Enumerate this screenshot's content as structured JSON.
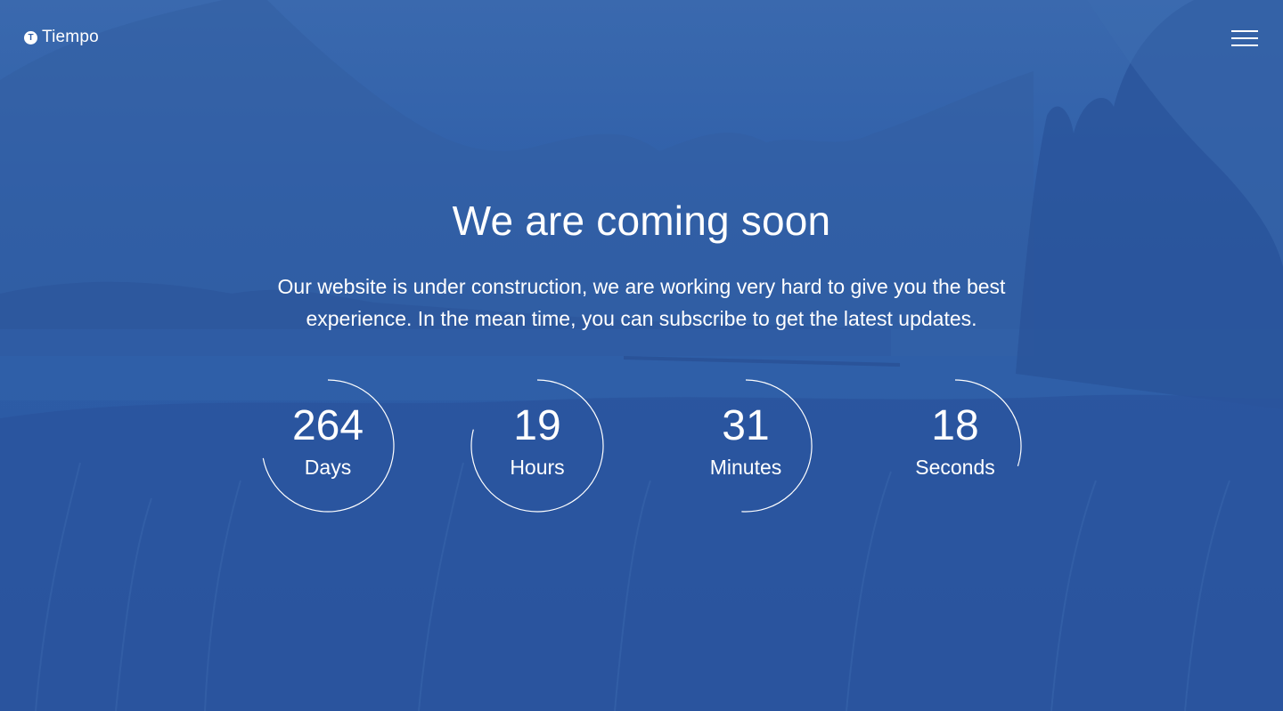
{
  "brand": {
    "mark": "T",
    "name": "Tiempo"
  },
  "hero": {
    "title": "We are coming soon",
    "description": "Our website is under construction, we are working very hard to give you the best experience. In the mean time, you can subscribe to get the latest updates."
  },
  "countdown": [
    {
      "value": "264",
      "label": "Days",
      "progress": 0.72
    },
    {
      "value": "19",
      "label": "Hours",
      "progress": 0.79
    },
    {
      "value": "31",
      "label": "Minutes",
      "progress": 0.51
    },
    {
      "value": "18",
      "label": "Seconds",
      "progress": 0.3
    }
  ],
  "colors": {
    "overlay": "#2d5ca6",
    "text": "#ffffff"
  },
  "icons": {
    "menu": "hamburger-menu-icon",
    "logo": "tiempo-logo-icon"
  }
}
